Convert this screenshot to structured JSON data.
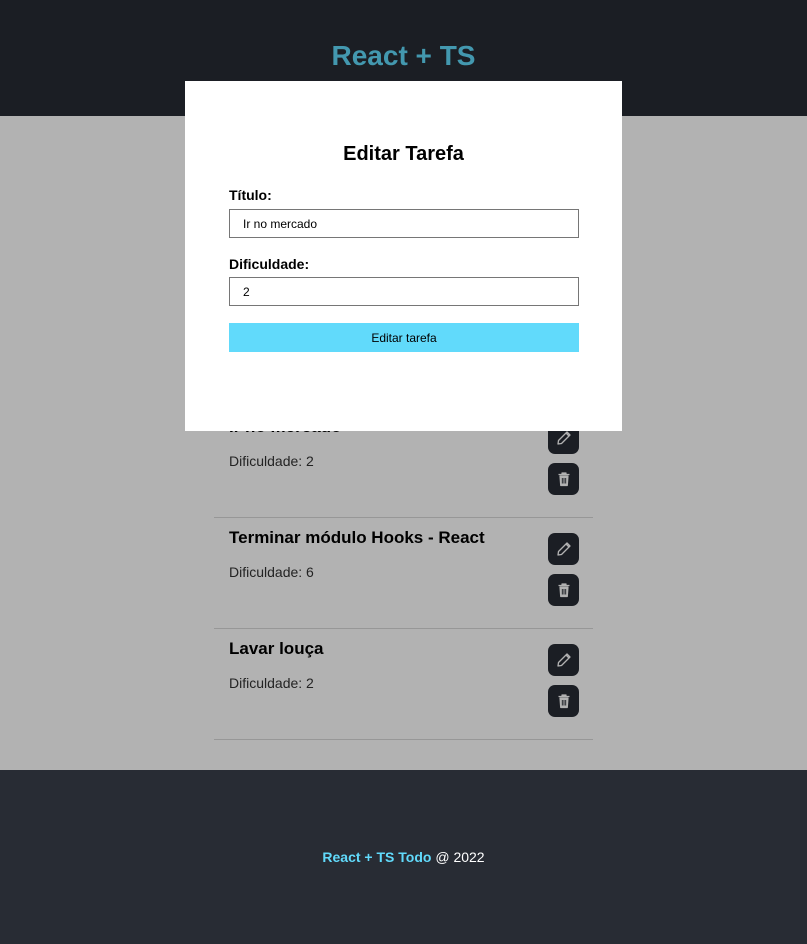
{
  "header": {
    "title": "React + TS"
  },
  "tasks": [
    {
      "title": "Ir no mercado",
      "difficulty_label": "Dificuldade: 2"
    },
    {
      "title": "Terminar módulo Hooks - React",
      "difficulty_label": "Dificuldade: 6"
    },
    {
      "title": "Lavar louça",
      "difficulty_label": "Dificuldade: 2"
    }
  ],
  "modal": {
    "title": "Editar Tarefa",
    "title_label": "Título:",
    "title_value": "Ir no mercado",
    "difficulty_label": "Dificuldade:",
    "difficulty_value": "2",
    "submit_label": "Editar tarefa"
  },
  "footer": {
    "brand": "React + TS Todo",
    "suffix": " @ 2022"
  },
  "icons": {
    "edit": "pencil-icon",
    "delete": "trash-icon"
  },
  "colors": {
    "accent": "#61dafb",
    "dark": "#282c34",
    "overlay": "rgba(0,0,0,0.3)"
  }
}
